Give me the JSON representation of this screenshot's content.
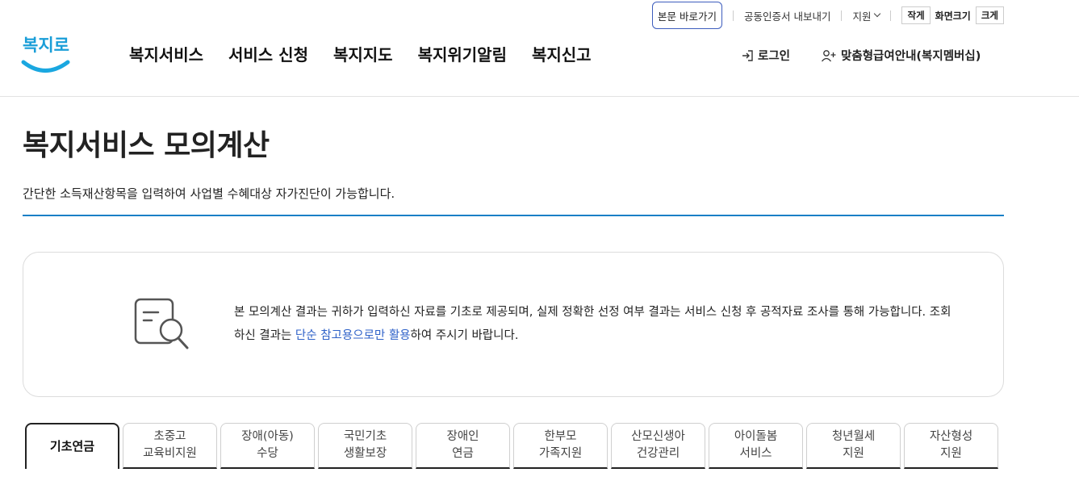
{
  "utility": {
    "skip_to_content": "본문 바로가기",
    "cert_export": "공동인증서 내보내기",
    "support": "지원",
    "size_small": "작게",
    "screen_size": "화면크기",
    "size_large": "크게"
  },
  "logo_text": "복지로",
  "gnb": [
    "복지서비스",
    "서비스 신청",
    "복지지도",
    "복지위기알림",
    "복지신고"
  ],
  "header_right": {
    "login": "로그인",
    "membership": "맞춤형급여안내(복지멤버십)"
  },
  "page": {
    "title": "복지서비스 모의계산",
    "description": "간단한 소득재산항목을 입력하여 사업별 수혜대상 자가진단이 가능합니다."
  },
  "notice": {
    "part1": "본 모의계산 결과는 귀하가 입력하신 자료를 기초로 제공되며, 실제 정확한 선정 여부 결과는 서비스 신청 후 공적자료 조사를 통해 가능합니다. 조회하신 결과는 ",
    "highlight": "단순 참고용으로만 활용",
    "part2": "하여 주시기 바랍니다."
  },
  "tabs": [
    {
      "line1": "기초연금",
      "line2": ""
    },
    {
      "line1": "초중고",
      "line2": "교육비지원"
    },
    {
      "line1": "장애(아동)",
      "line2": "수당"
    },
    {
      "line1": "국민기초",
      "line2": "생활보장"
    },
    {
      "line1": "장애인",
      "line2": "연금"
    },
    {
      "line1": "한부모",
      "line2": "가족지원"
    },
    {
      "line1": "산모신생아",
      "line2": "건강관리"
    },
    {
      "line1": "아이돌봄",
      "line2": "서비스"
    },
    {
      "line1": "청년월세",
      "line2": "지원"
    },
    {
      "line1": "자산형성",
      "line2": "지원"
    }
  ],
  "colors": {
    "accent_blue": "#1a7fc6",
    "link_blue": "#2f62c8",
    "logo_blue": "#1a9ed8"
  }
}
